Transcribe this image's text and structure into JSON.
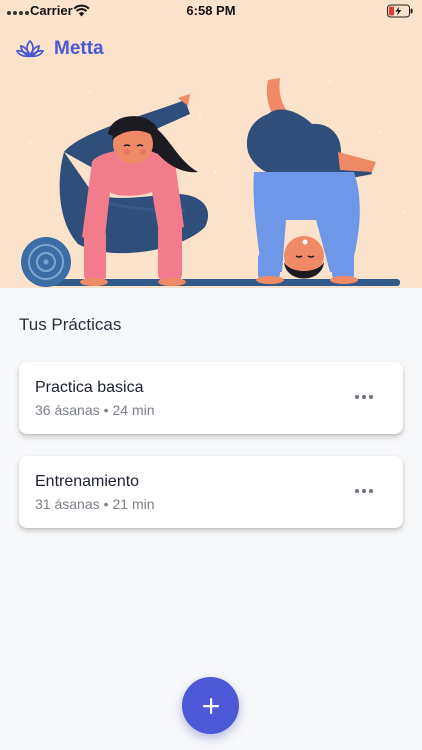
{
  "status_bar": {
    "carrier": "Carrier",
    "time": "6:58 PM",
    "icons": [
      "signal-dots-icon",
      "wifi-icon",
      "battery-charging-icon"
    ]
  },
  "app": {
    "title": "Metta",
    "logo_icon": "lotus-icon",
    "accent": "#4a57cf"
  },
  "hero": {
    "illustration": "yoga-illustration",
    "background": "#fbe3cb"
  },
  "practices": {
    "heading": "Tus Prácticas",
    "items": [
      {
        "title": "Practica basica",
        "asanas": "36 ásanas",
        "separator": "•",
        "duration": "24 min",
        "menu_icon": "more-horizontal-icon"
      },
      {
        "title": "Entrenamiento",
        "asanas": "31 ásanas",
        "separator": "•",
        "duration": "21 min",
        "menu_icon": "more-horizontal-icon"
      }
    ]
  },
  "fab": {
    "icon": "plus-icon",
    "color": "#4d58d6"
  }
}
